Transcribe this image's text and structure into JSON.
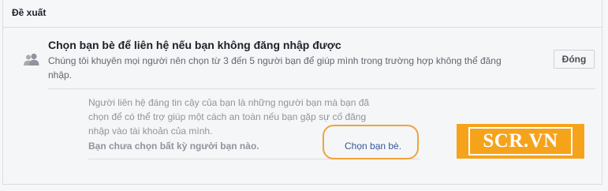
{
  "section": {
    "title": "Đề xuất"
  },
  "card": {
    "title": "Chọn bạn bè để liên hệ nếu bạn không đăng nhập được",
    "description": "Chúng tôi khuyên mọi người nên chọn từ 3 đến 5 người bạn để giúp mình trong trường hợp không thể đăng nhập.",
    "done_label": "Đóng",
    "icon": "people-icon"
  },
  "contacts": {
    "description": "Người liên hệ đáng tin cậy của bạn là những người bạn mà bạn đã chọn để có thể trợ giúp một cách an toàn nếu bạn gặp sự cố đăng nhập vào tài khoản của mình.",
    "empty_state": "Bạn chưa chọn bất kỳ người bạn nào.",
    "choose_link": "Chọn bạn bè."
  },
  "watermark": {
    "text": "SCR.VN"
  },
  "colors": {
    "background": "#f6f7f9",
    "link": "#365899",
    "highlight": "#f0a33a",
    "watermark": "#f6a31c"
  }
}
